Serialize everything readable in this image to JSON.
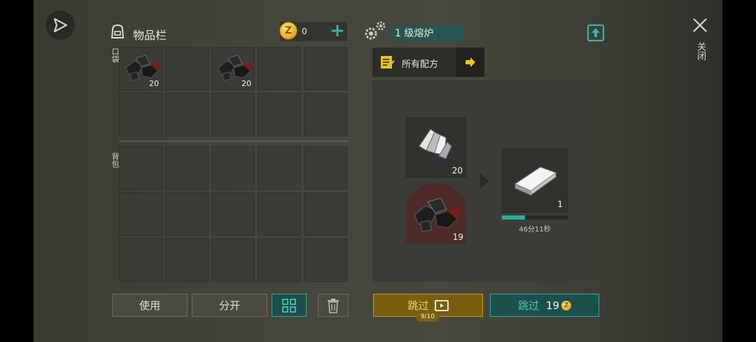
{
  "inventory": {
    "title": "物品栏",
    "coin_count": "0",
    "section_pocket": "口袋",
    "section_backpack": "背包",
    "pocket_items": [
      {
        "slot": 1,
        "icon": "coal-icon",
        "count": "20"
      },
      {
        "slot": 3,
        "icon": "coal-icon",
        "count": "20"
      }
    ],
    "buttons": {
      "use": "使用",
      "split": "分开"
    }
  },
  "furnace": {
    "title": "1 级熔炉",
    "recipes_label": "所有配方",
    "input": {
      "icon": "iron-ore-icon",
      "count": "20"
    },
    "fuel": {
      "icon": "coal-icon",
      "count": "19"
    },
    "output": {
      "icon": "iron-ingot-icon",
      "count": "1"
    },
    "progress": 0.35,
    "timer": "46分11秒",
    "skip_ad_label": "跳过",
    "skip_ad_counter": "9/10",
    "skip_coin_label": "跳过",
    "skip_coin_cost": "19"
  },
  "close_label": "关闭",
  "colors": {
    "accent_teal": "#2fa8a0",
    "accent_yellow": "#e8c21f",
    "gold": "#f0c030"
  }
}
